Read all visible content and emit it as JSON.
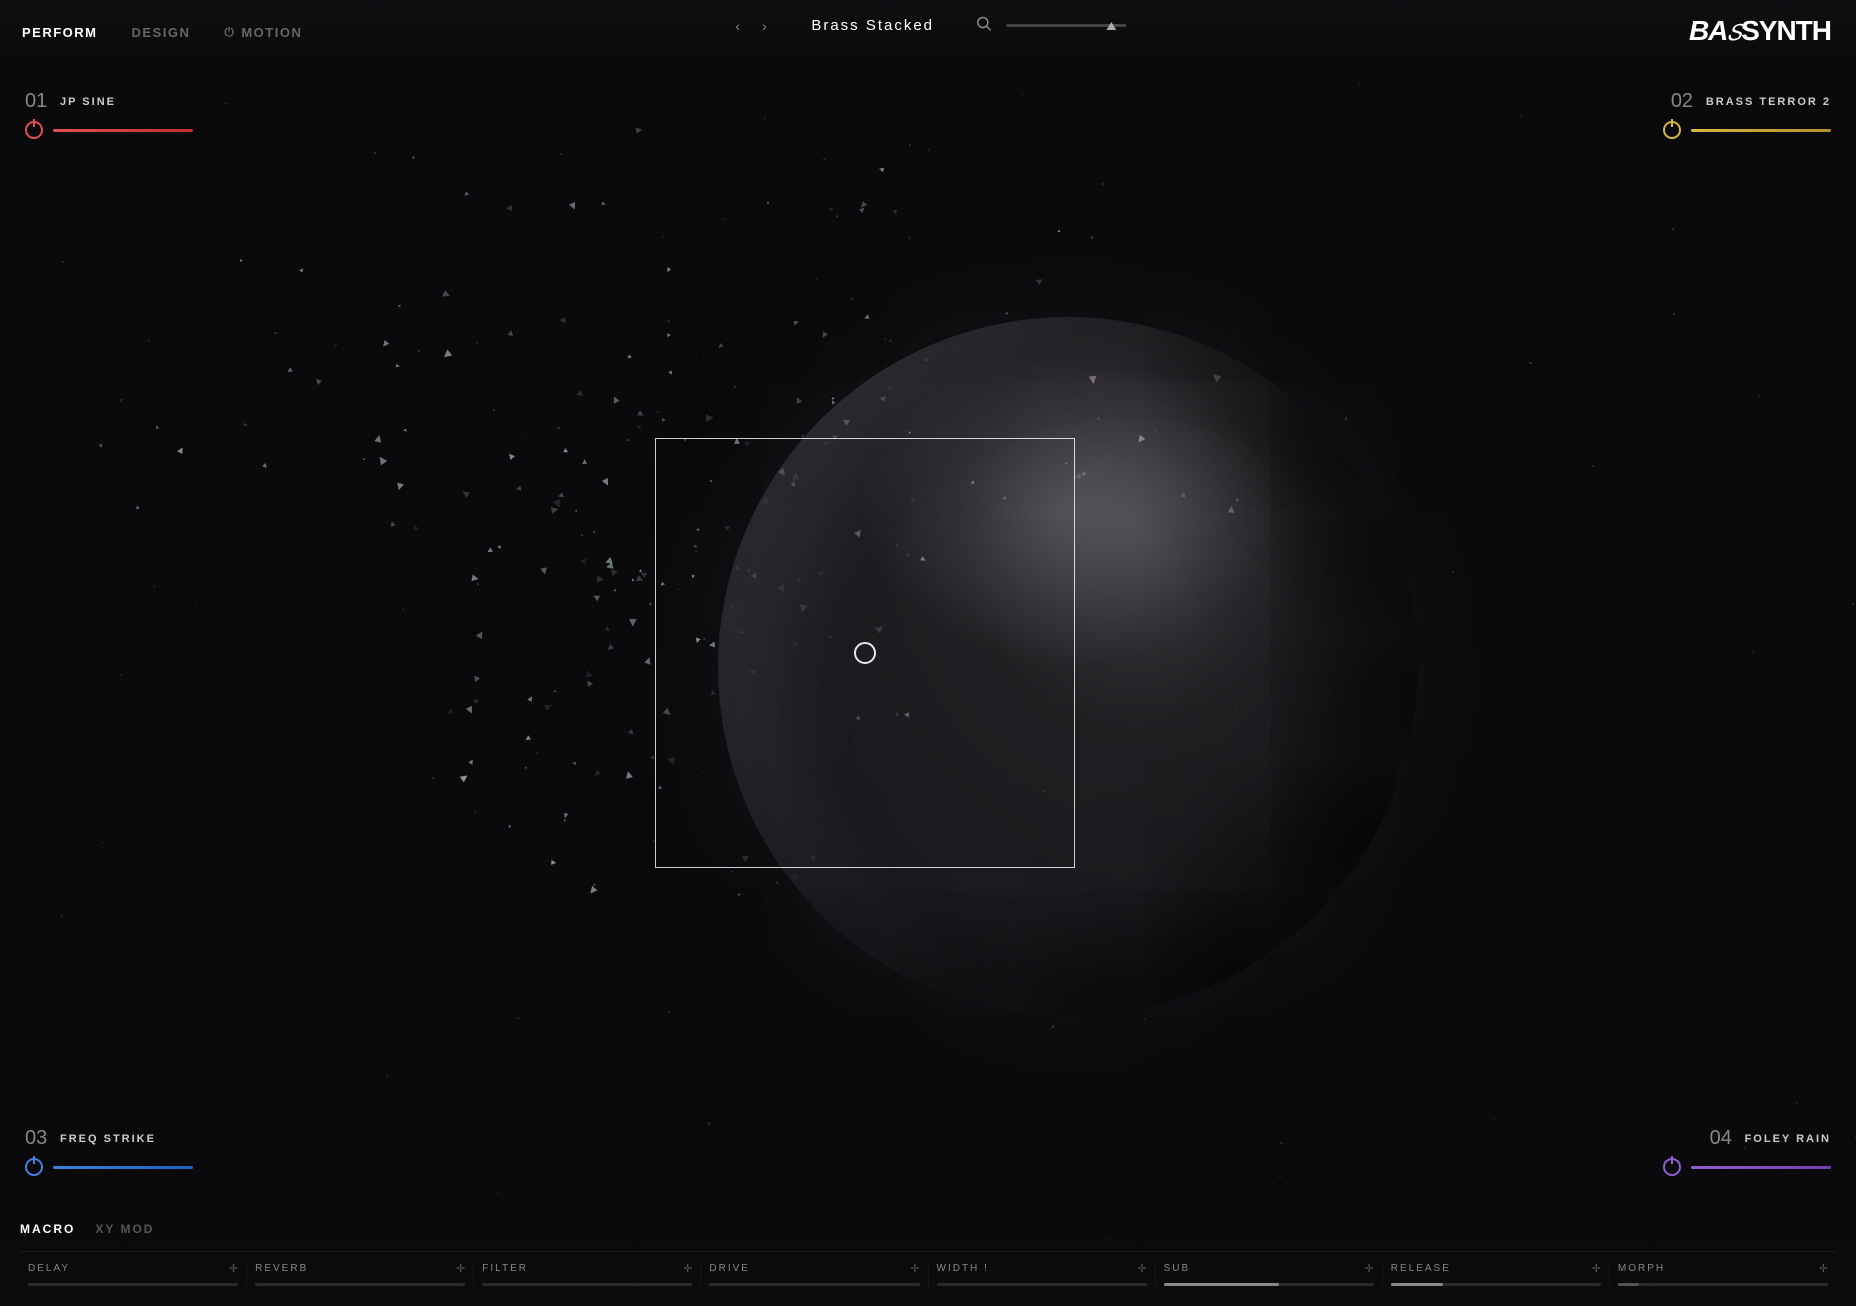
{
  "nav": {
    "tabs": [
      {
        "id": "perform",
        "label": "PERFORM",
        "active": true
      },
      {
        "id": "design",
        "label": "DESIGN",
        "active": false
      },
      {
        "id": "motion",
        "label": "MOTION",
        "active": false
      }
    ],
    "motion_icon": "⏻"
  },
  "preset": {
    "name": "Brass Stacked",
    "prev_arrow": "‹",
    "next_arrow": "›",
    "search_icon": "🔍"
  },
  "logo": {
    "text": "BASYNTH",
    "display": "BA𝑆SYNTH"
  },
  "layers": [
    {
      "id": "layer-01",
      "num": "01",
      "name": "JP SINE",
      "color": "red",
      "position": "top-left"
    },
    {
      "id": "layer-02",
      "num": "02",
      "name": "BRASS TERROR 2",
      "color": "yellow",
      "position": "top-right"
    },
    {
      "id": "layer-03",
      "num": "03",
      "name": "FREQ STRIKE",
      "color": "blue",
      "position": "bottom-left"
    },
    {
      "id": "layer-04",
      "num": "04",
      "name": "FOLEY RAIN",
      "color": "purple",
      "position": "bottom-right"
    }
  ],
  "macro": {
    "tabs": [
      {
        "id": "macro",
        "label": "MACRO",
        "active": true
      },
      {
        "id": "xy-mod",
        "label": "XY MOD",
        "active": false
      }
    ],
    "sliders": [
      {
        "id": "delay",
        "label": "DELAY",
        "value": 0
      },
      {
        "id": "reverb",
        "label": "REVERB",
        "value": 0
      },
      {
        "id": "filter",
        "label": "FILTER",
        "value": 0
      },
      {
        "id": "drive",
        "label": "DRIVE",
        "value": 0
      },
      {
        "id": "width",
        "label": "WIDTH !",
        "value": 0
      },
      {
        "id": "sub",
        "label": "SUB",
        "value": 55
      },
      {
        "id": "release",
        "label": "RELEASE",
        "value": 25
      },
      {
        "id": "morph",
        "label": "MORPH",
        "value": 10
      }
    ],
    "drag_icon": "⊕"
  }
}
